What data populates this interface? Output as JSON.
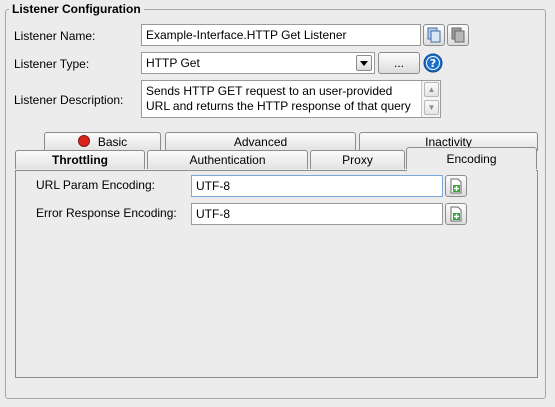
{
  "group_title": "Listener Configuration",
  "fields": {
    "name_label": "Listener Name:",
    "name_value": "Example-Interface.HTTP Get Listener",
    "type_label": "Listener Type:",
    "type_value": "HTTP Get",
    "type_more_label": "...",
    "description_label": "Listener Description:",
    "description_line1": "Sends HTTP GET request to an user-provided",
    "description_line2": "URL and returns the HTTP response of that query"
  },
  "tabs": {
    "row_back": [
      "Basic",
      "Advanced",
      "Inactivity"
    ],
    "row_front": [
      "Throttling",
      "Authentication",
      "Proxy",
      "Encoding"
    ],
    "selected": "Encoding",
    "basic_status_color": "#d9261c"
  },
  "encoding": {
    "url_param_label": "URL Param Encoding:",
    "url_param_value": "UTF-8",
    "error_response_label": "Error Response Encoding:",
    "error_response_value": "UTF-8"
  },
  "icons": [
    "copy-icon",
    "paste-icon",
    "help-icon",
    "dropdown-arrow-icon",
    "add-variable-icon"
  ],
  "colors": {
    "help_icon": "#1a6fc9",
    "add_icon": "#3aa53a"
  }
}
